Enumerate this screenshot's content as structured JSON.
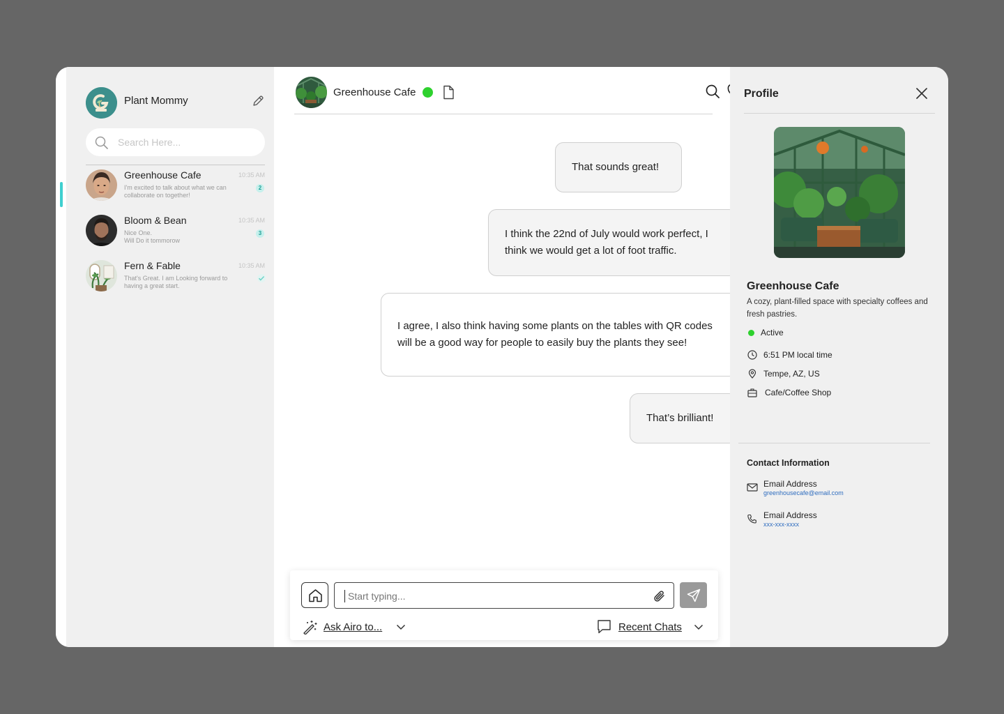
{
  "sidebar": {
    "user_name": "Plant Mommy",
    "search_placeholder": "Search Here...",
    "chats": [
      {
        "name": "Greenhouse Cafe",
        "time": "10:35 AM",
        "preview": "I'm excited to talk about what we can collaborate on together!",
        "unread": "2",
        "active": true
      },
      {
        "name": "Bloom & Bean",
        "time": "10:35 AM",
        "preview_line1": "Nice One.",
        "preview_line2": "Will Do it tommorow",
        "unread": "3"
      },
      {
        "name": "Fern & Fable",
        "time": "10:35 AM",
        "preview": "That's Great. I am Looking forward to having a great start.",
        "status": "read"
      }
    ]
  },
  "chat": {
    "contact_name": "Greenhouse Cafe",
    "status": "online",
    "messages": [
      {
        "direction": "sent",
        "text": "That sounds great!"
      },
      {
        "direction": "sent",
        "text": "I think the 22nd of July would work perfect, I think we would get a lot of foot traffic."
      },
      {
        "direction": "received",
        "text": "I agree, I also think having some plants on the tables with QR codes will be a good way for people to easily buy the plants they see!"
      },
      {
        "direction": "sent",
        "text": "That’s brilliant!"
      }
    ],
    "composer": {
      "placeholder": "Start typing...",
      "ask_label": "Ask Airo to...",
      "recent_label": "Recent Chats"
    }
  },
  "profile": {
    "title": "Profile",
    "name": "Greenhouse Cafe",
    "description": "A cozy, plant-filled space with specialty coffees and fresh pastries.",
    "status": "Active",
    "local_time": "6:51 PM local time",
    "location": "Tempe, AZ, US",
    "category": "Cafe/Coffee Shop",
    "contact_title": "Contact Information",
    "contacts": [
      {
        "label": "Email Address",
        "value": "greenhousecafe@email.com"
      },
      {
        "label": "Email Address",
        "value": "xxx-xxx-xxxx"
      }
    ]
  },
  "colors": {
    "accent_teal": "#3fcfcf",
    "online_green": "#2ed12e",
    "link_blue": "#2f6dbf",
    "badge_bg": "#c6f0ec"
  },
  "icons": [
    "edit-icon",
    "search-icon",
    "document-icon",
    "heart-icon",
    "bell-icon",
    "close-icon",
    "home-icon",
    "paperclip-icon",
    "send-icon",
    "magic-wand-icon",
    "chat-bubble-icon",
    "chevron-down-icon",
    "clock-icon",
    "location-pin-icon",
    "briefcase-icon",
    "mail-icon",
    "phone-icon",
    "check-icon"
  ]
}
